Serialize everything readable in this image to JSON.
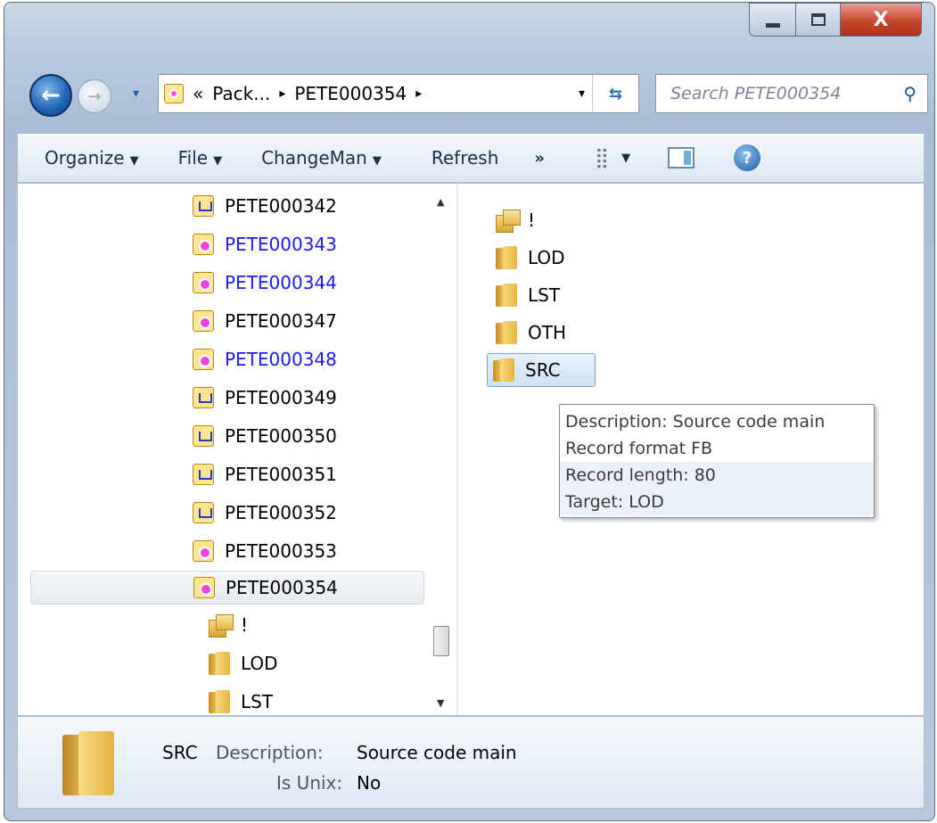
{
  "window": {
    "close_glyph": "X"
  },
  "nav": {
    "back_glyph": "←",
    "forward_glyph": "→",
    "recent_glyph": "▾",
    "address": {
      "overflow": "«",
      "crumbs": [
        "Pack...",
        "PETE000354"
      ],
      "separator": "▸",
      "dropdown": "▾",
      "refresh_glyph": "⇆"
    },
    "search": {
      "placeholder": "Search PETE000354",
      "icon_glyph": "⚲"
    }
  },
  "toolbar": {
    "organize": "Organize",
    "file": "File",
    "changeman": "ChangeMan",
    "refresh": "Refresh",
    "more": "»",
    "arrow": "▼",
    "views_glyph": "⣿",
    "help_glyph": "?"
  },
  "tree": {
    "items": [
      {
        "label": "PETE000342",
        "icon": "blue-package-icon",
        "color": "#000000"
      },
      {
        "label": "PETE000343",
        "icon": "pink-package-icon",
        "color": "#1a1aff"
      },
      {
        "label": "PETE000344",
        "icon": "pink-package-icon",
        "color": "#1a1aff"
      },
      {
        "label": "PETE000347",
        "icon": "pink-package-icon",
        "color": "#000000"
      },
      {
        "label": "PETE000348",
        "icon": "pink-package-icon",
        "color": "#1a1aff"
      },
      {
        "label": "PETE000349",
        "icon": "blue-package-icon",
        "color": "#000000"
      },
      {
        "label": "PETE000350",
        "icon": "blue-package-icon",
        "color": "#000000"
      },
      {
        "label": "PETE000351",
        "icon": "blue-package-icon",
        "color": "#000000"
      },
      {
        "label": "PETE000352",
        "icon": "blue-package-icon",
        "color": "#000000"
      },
      {
        "label": "PETE000353",
        "icon": "pink-package-icon",
        "color": "#000000"
      },
      {
        "label": "PETE000354",
        "icon": "pink-package-icon",
        "color": "#000000",
        "selected": true
      }
    ],
    "children": [
      {
        "label": "!",
        "icon": "multi-folder-icon"
      },
      {
        "label": "LOD",
        "icon": "folder-icon"
      },
      {
        "label": "LST",
        "icon": "folder-icon"
      }
    ],
    "scroll_up": "▲",
    "scroll_down": "▼"
  },
  "content": {
    "items": [
      {
        "label": "!",
        "icon": "multi-folder-icon"
      },
      {
        "label": "LOD",
        "icon": "folder-icon"
      },
      {
        "label": "LST",
        "icon": "folder-icon"
      },
      {
        "label": "OTH",
        "icon": "folder-icon"
      },
      {
        "label": "SRC",
        "icon": "folder-icon",
        "selected": true
      }
    ]
  },
  "tooltip": {
    "lines": [
      "Description: Source code main",
      "Record format FB",
      "Record length: 80",
      "Target: LOD"
    ]
  },
  "details": {
    "name": "SRC",
    "description_label": "Description:",
    "description_value": "Source code main",
    "unix_label": "Is Unix:",
    "unix_value": "No"
  }
}
